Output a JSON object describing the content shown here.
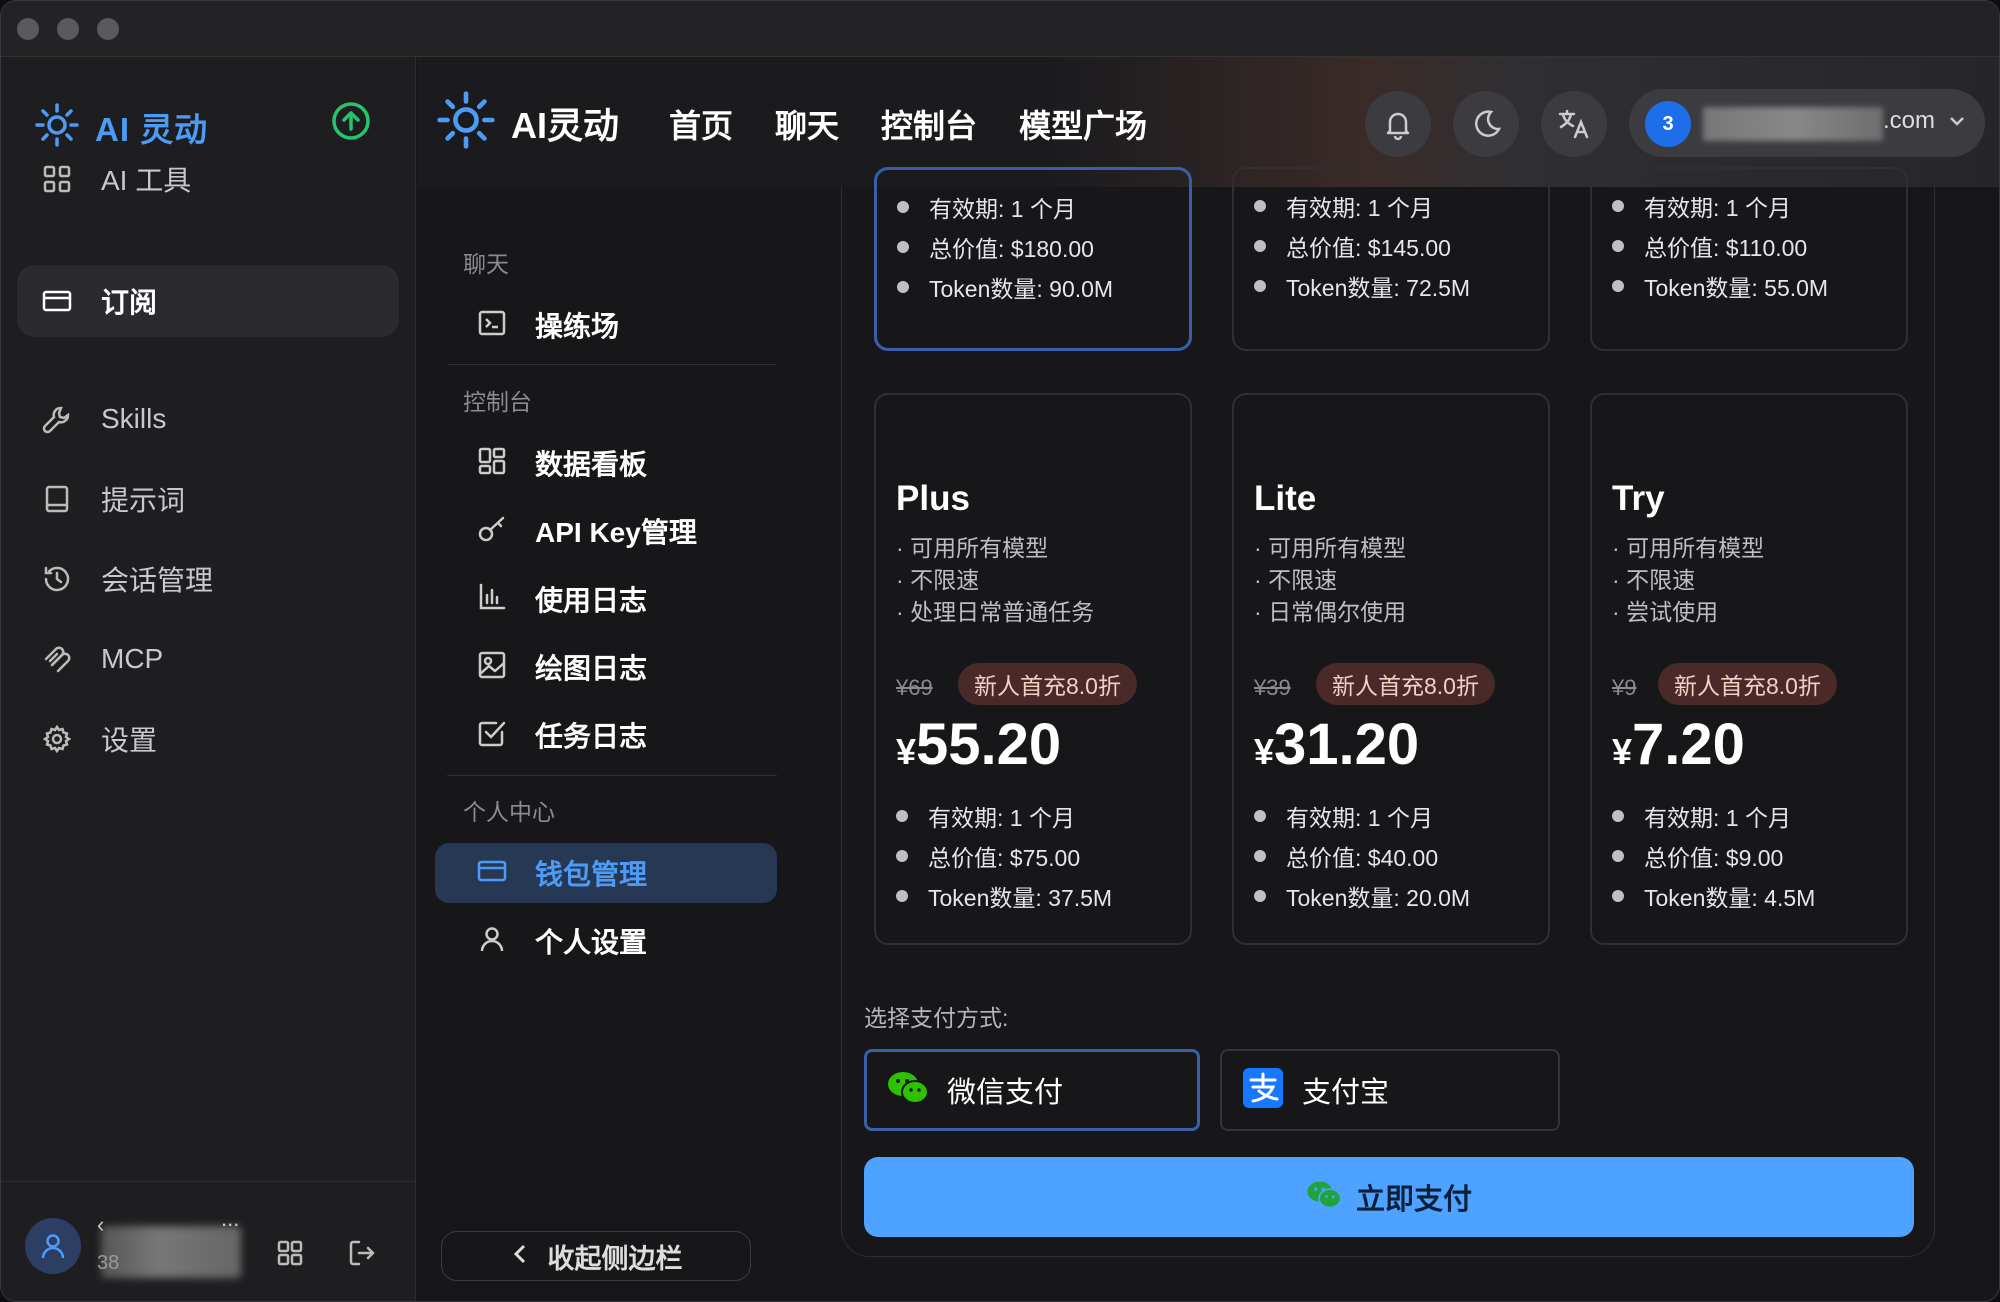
{
  "sidebar": {
    "brand": "AI 灵动",
    "items": [
      {
        "label": "AI 工具",
        "icon": "grid-icon"
      },
      {
        "label": "订阅",
        "icon": "card-icon"
      },
      {
        "label": "Skills",
        "icon": "wrench-icon"
      },
      {
        "label": "提示词",
        "icon": "book-icon"
      },
      {
        "label": "会话管理",
        "icon": "history-icon"
      },
      {
        "label": "MCP",
        "icon": "mcp-icon"
      },
      {
        "label": "设置",
        "icon": "gear-icon"
      }
    ],
    "active_index": 1,
    "user": {
      "prefix": "‹",
      "sub": "38",
      "more": "..."
    }
  },
  "topbar": {
    "brand": "AI灵动",
    "nav": [
      "首页",
      "聊天",
      "控制台",
      "模型广场"
    ],
    "account": {
      "badge": "3",
      "domain": ".com"
    }
  },
  "subnav": {
    "sections": [
      {
        "title": "聊天",
        "items": [
          {
            "label": "操练场",
            "icon": "terminal-icon"
          }
        ]
      },
      {
        "title": "控制台",
        "items": [
          {
            "label": "数据看板",
            "icon": "dashboard-icon"
          },
          {
            "label": "API Key管理",
            "icon": "key-icon"
          },
          {
            "label": "使用日志",
            "icon": "bar-chart-icon"
          },
          {
            "label": "绘图日志",
            "icon": "image-icon"
          },
          {
            "label": "任务日志",
            "icon": "checkbox-icon"
          }
        ]
      },
      {
        "title": "个人中心",
        "items": [
          {
            "label": "钱包管理",
            "icon": "wallet-icon"
          },
          {
            "label": "个人设置",
            "icon": "user-icon"
          }
        ]
      }
    ],
    "collapse_label": "收起侧边栏"
  },
  "plans_top": [
    {
      "validity": "有效期: 1 个月",
      "total": "总价值: $180.00",
      "tokens": "Token数量: 90.0M"
    },
    {
      "validity": "有效期: 1 个月",
      "total": "总价值: $145.00",
      "tokens": "Token数量: 72.5M"
    },
    {
      "validity": "有效期: 1 个月",
      "total": "总价值: $110.00",
      "tokens": "Token数量: 55.0M"
    }
  ],
  "plans": [
    {
      "name": "Plus",
      "features": [
        "可用所有模型",
        "不限速",
        "处理日常普通任务"
      ],
      "original": "¥69",
      "promo": "新人首充8.0折",
      "currency": "¥",
      "price": "55.20",
      "validity": "有效期: 1 个月",
      "total": "总价值: $75.00",
      "tokens": "Token数量: 37.5M"
    },
    {
      "name": "Lite",
      "features": [
        "可用所有模型",
        "不限速",
        "日常偶尔使用"
      ],
      "original": "¥39",
      "promo": "新人首充8.0折",
      "currency": "¥",
      "price": "31.20",
      "validity": "有效期: 1 个月",
      "total": "总价值: $40.00",
      "tokens": "Token数量: 20.0M"
    },
    {
      "name": "Try",
      "features": [
        "可用所有模型",
        "不限速",
        "尝试使用"
      ],
      "original": "¥9",
      "promo": "新人首充8.0折",
      "currency": "¥",
      "price": "7.20",
      "validity": "有效期: 1 个月",
      "total": "总价值: $9.00",
      "tokens": "Token数量: 4.5M"
    }
  ],
  "payment": {
    "title": "选择支付方式:",
    "options": [
      {
        "label": "微信支付",
        "icon": "wechat-icon"
      },
      {
        "label": "支付宝",
        "icon": "alipay-icon"
      }
    ],
    "selected": 0,
    "pay_label": "立即支付"
  },
  "colors": {
    "accent": "#4c9bf5",
    "pay_button": "#4da3ff",
    "promo_bg": "#4a2a28",
    "wechat": "#2dc100",
    "alipay": "#1677ff",
    "upgrade": "#27c46e"
  }
}
